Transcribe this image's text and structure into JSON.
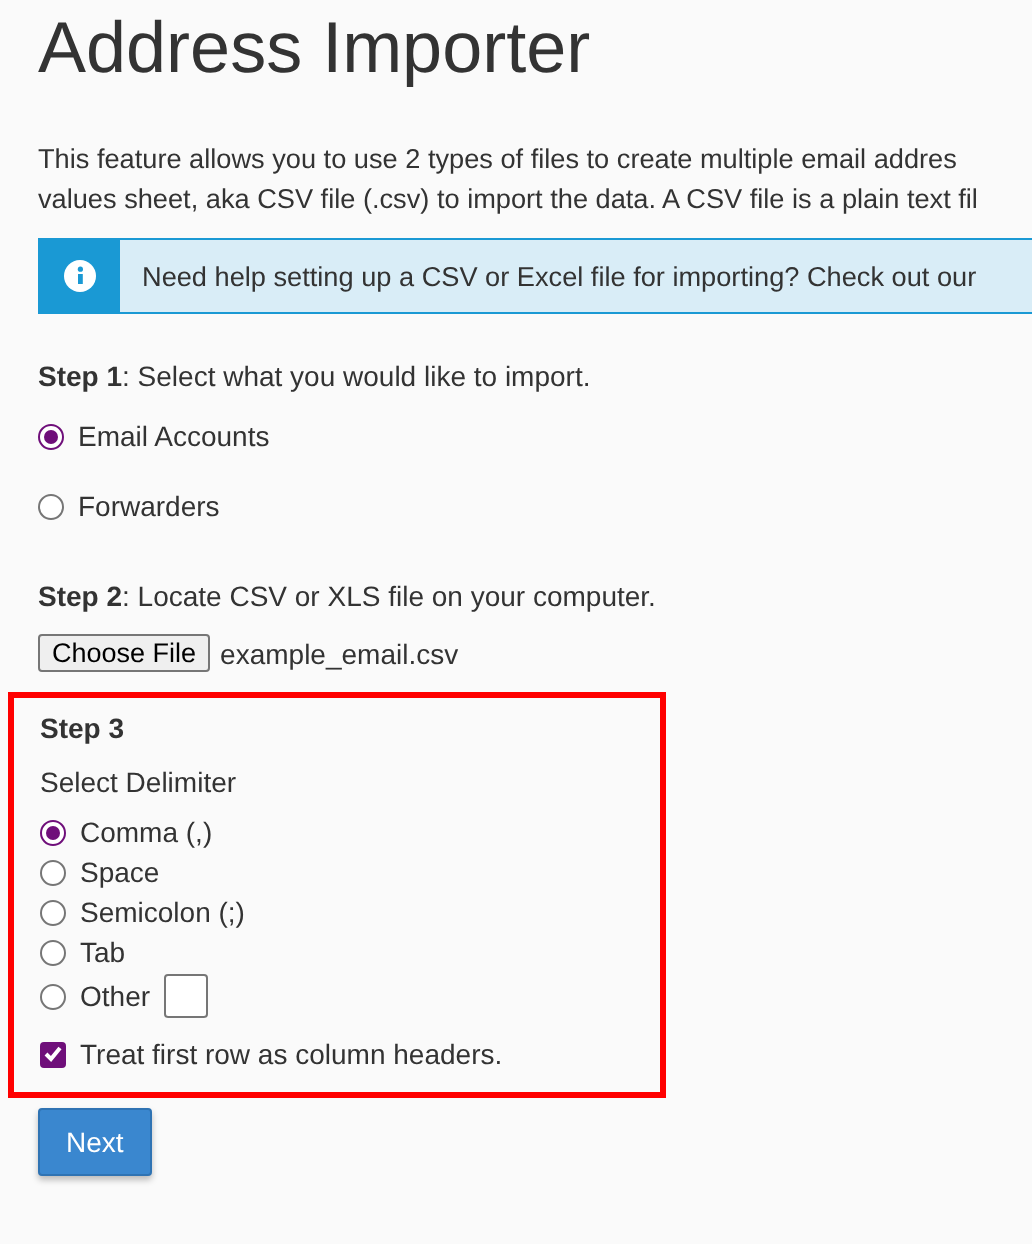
{
  "title": "Address Importer",
  "intro": [
    "This feature allows you to use 2 types of files to create multiple email addres",
    "values sheet, aka CSV file (.csv) to import the data. A CSV file is a plain text fil"
  ],
  "alert": {
    "text": "Need help setting up a CSV or Excel file for importing? Check out our"
  },
  "step1": {
    "label": "**Step 1**: Select what you would like to import.",
    "options": [
      {
        "label": "Email Accounts",
        "selected": true
      },
      {
        "label": "Forwarders",
        "selected": false
      }
    ]
  },
  "step2": {
    "label": "**Step 2**: Locate CSV or XLS file on your computer.",
    "button": "Choose File",
    "file": "example_email.csv"
  },
  "step3": {
    "heading": "Step 3",
    "subheading": "Select Delimiter",
    "options": [
      {
        "label": "Comma (,)",
        "selected": true,
        "kind": "plain"
      },
      {
        "label": "Space",
        "selected": false,
        "kind": "plain"
      },
      {
        "label": "Semicolon (;)",
        "selected": false,
        "kind": "plain"
      },
      {
        "label": "Tab",
        "selected": false,
        "kind": "plain"
      },
      {
        "label": "Other",
        "selected": false,
        "kind": "input"
      }
    ],
    "header_row": {
      "label": "Treat first row as column headers.",
      "checked": true
    }
  },
  "next": "Next"
}
